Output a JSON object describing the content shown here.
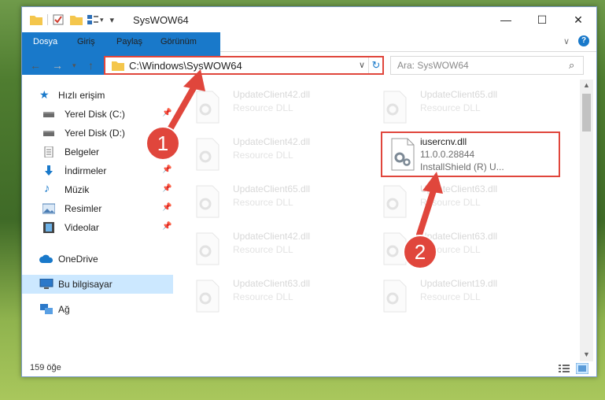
{
  "window": {
    "title": "SysWOW64",
    "controls": {
      "minimize": "—",
      "maximize": "☐",
      "close": "✕"
    }
  },
  "ribbon": {
    "tabs": [
      "Dosya",
      "Giriş",
      "Paylaş",
      "Görünüm"
    ]
  },
  "address": {
    "path": "C:\\Windows\\SysWOW64",
    "search_placeholder": "Ara: SysWOW64"
  },
  "nav": {
    "items": [
      {
        "label": "Hızlı erişim",
        "icon": "star-icon",
        "pinned": false
      },
      {
        "label": "Yerel Disk (C:)",
        "icon": "drive-icon",
        "pinned": true
      },
      {
        "label": "Yerel Disk (D:)",
        "icon": "drive-icon",
        "pinned": false
      },
      {
        "label": "Belgeler",
        "icon": "documents-icon",
        "pinned": true
      },
      {
        "label": "İndirmeler",
        "icon": "download-icon",
        "pinned": true
      },
      {
        "label": "Müzik",
        "icon": "music-icon",
        "pinned": true
      },
      {
        "label": "Resimler",
        "icon": "pictures-icon",
        "pinned": true
      },
      {
        "label": "Videolar",
        "icon": "video-icon",
        "pinned": true
      },
      {
        "label": "OneDrive",
        "icon": "cloud-icon",
        "pinned": false
      },
      {
        "label": "Bu bilgisayar",
        "icon": "computer-icon",
        "pinned": false
      },
      {
        "label": "Ağ",
        "icon": "network-icon",
        "pinned": false
      }
    ]
  },
  "files": [
    {
      "name": "UpdateClient42.dll",
      "type": "Resource DLL"
    },
    {
      "name": "UpdateClient65.dll",
      "type": "Resource DLL"
    },
    {
      "name": "UpdateClient42.dll",
      "type": "Resource DLL"
    },
    {
      "name": "iusercnv.dll",
      "type": "11.0.0.28844",
      "extra": "InstallShield (R) U..."
    },
    {
      "name": "UpdateClient65.dll",
      "type": "Resource DLL"
    },
    {
      "name": "UpdateClient63.dll",
      "type": "Resource DLL"
    },
    {
      "name": "UpdateClient42.dll",
      "type": "Resource DLL"
    },
    {
      "name": "UpdateClient63.dll",
      "type": "Resource DLL"
    },
    {
      "name": "UpdateClient63.dll",
      "type": "Resource DLL"
    },
    {
      "name": "UpdateClient19.dll",
      "type": "Resource DLL"
    }
  ],
  "status": {
    "count": "159 öğe"
  },
  "annotations": {
    "step1": "1",
    "step2": "2"
  },
  "colors": {
    "accent": "#1979ca",
    "highlight": "#e0463c",
    "selected_nav": "#cce8ff"
  }
}
